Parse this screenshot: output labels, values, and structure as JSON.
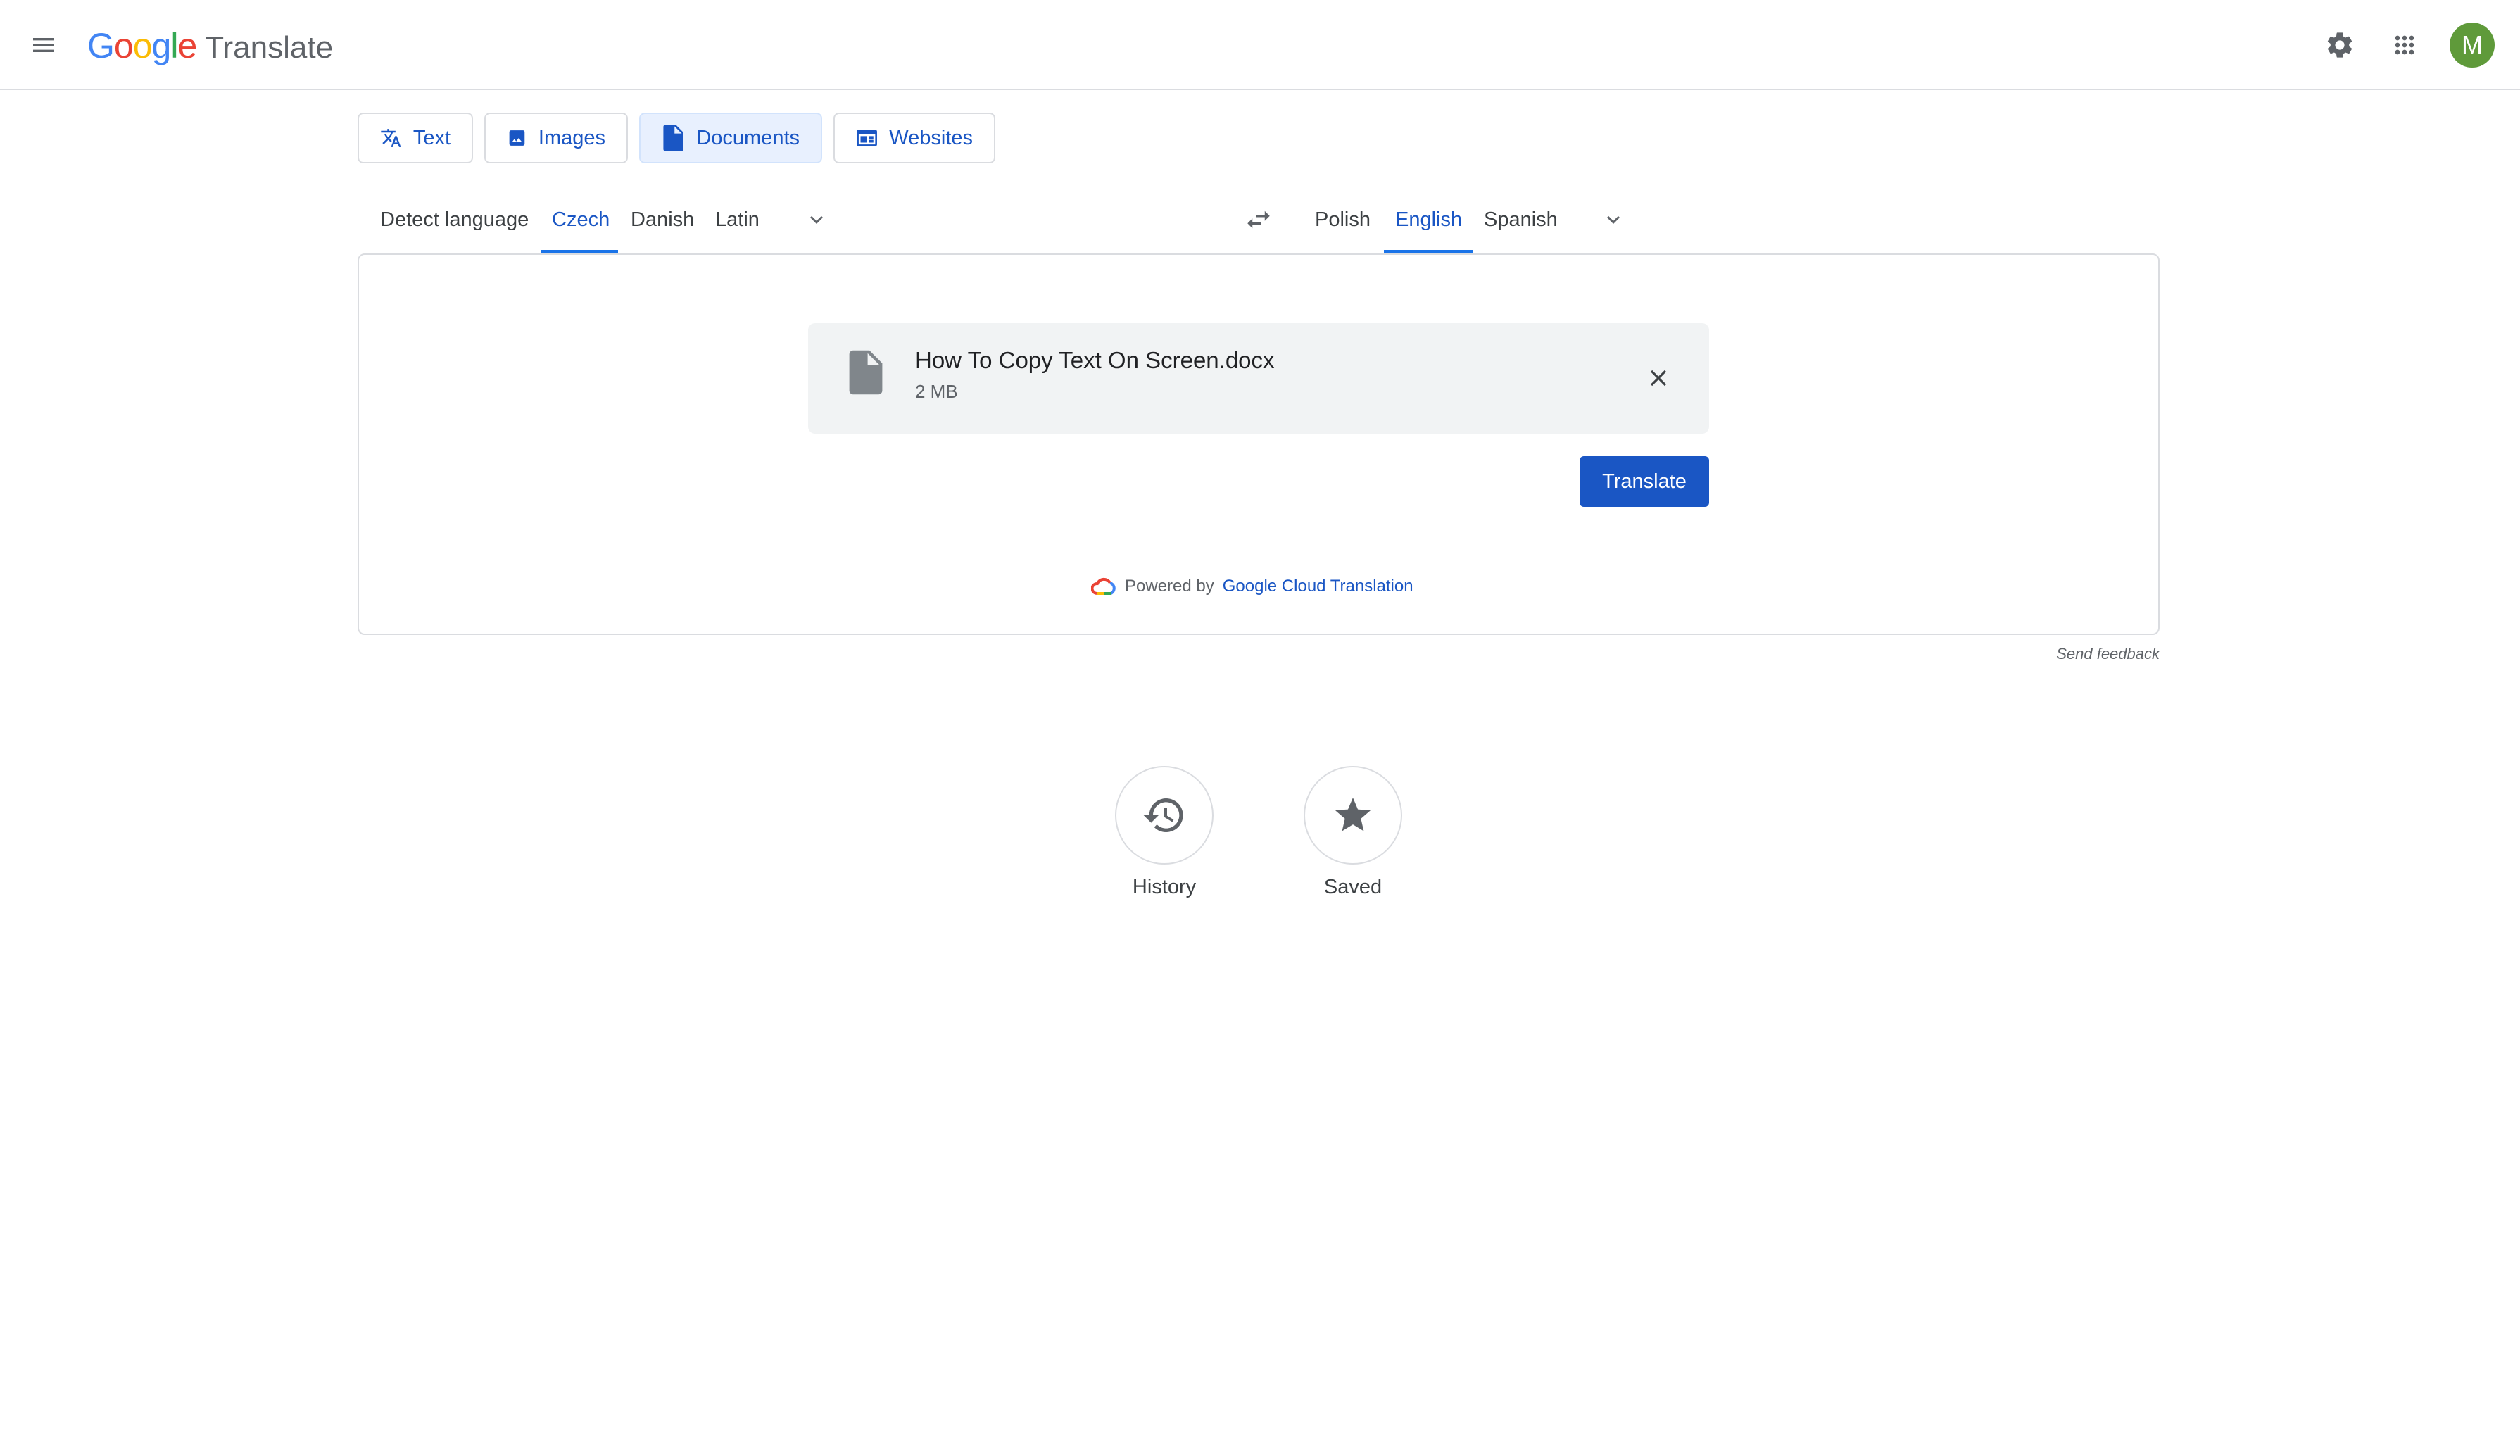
{
  "header": {
    "logo_letters": [
      "G",
      "o",
      "o",
      "g",
      "l",
      "e"
    ],
    "logo_colors": [
      "#4285F4",
      "#EA4335",
      "#FBBC05",
      "#4285F4",
      "#34A853",
      "#EA4335"
    ],
    "app_name": "Translate",
    "avatar_letter": "M"
  },
  "modes": [
    {
      "label": "Text",
      "icon": "translate-icon"
    },
    {
      "label": "Images",
      "icon": "image-icon"
    },
    {
      "label": "Documents",
      "icon": "document-icon",
      "active": true
    },
    {
      "label": "Websites",
      "icon": "website-icon"
    }
  ],
  "source_languages": {
    "items": [
      "Detect language",
      "Czech",
      "Danish",
      "Latin"
    ],
    "selected": "Czech"
  },
  "target_languages": {
    "items": [
      "Polish",
      "English",
      "Spanish"
    ],
    "selected": "English"
  },
  "file": {
    "name": "How To Copy Text On Screen.docx",
    "size": "2 MB"
  },
  "actions": {
    "translate_label": "Translate"
  },
  "powered": {
    "prefix": "Powered by",
    "link": "Google Cloud Translation"
  },
  "feedback_label": "Send feedback",
  "bottom": {
    "history_label": "History",
    "saved_label": "Saved"
  },
  "colors": {
    "accent": "#1a73e8",
    "accent_text": "#1a56c4",
    "avatar": "#5f9a3a",
    "file_card_bg": "#f1f3f4"
  }
}
